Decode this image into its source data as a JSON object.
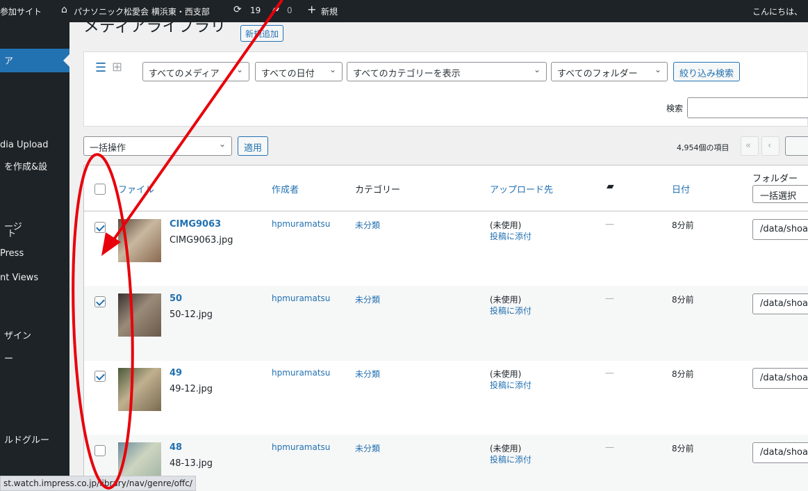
{
  "adminbar": {
    "site_label": "参加サイト",
    "site_name": "パナソニック松愛会 横浜東・西支部",
    "updates_count": "19",
    "comments_count": "0",
    "new_label": "新規",
    "greeting": "こんにちは、"
  },
  "sidebar": {
    "items": [
      "ア",
      "dia Upload",
      "を作成&設",
      "ージ",
      "ト",
      "Press",
      "nt Views",
      "ザイン",
      "ー",
      "ルドグルー"
    ]
  },
  "page": {
    "title": "メディアライブラリ",
    "add_new": "新規追加"
  },
  "filters": {
    "media_type": "すべてのメディア",
    "dates": "すべての日付",
    "categories": "すべてのカテゴリーを表示",
    "folders": "すべてのフォルダー",
    "filter_button": "絞り込み検索",
    "search_label": "検索"
  },
  "bulk": {
    "action": "一括操作",
    "apply": "適用",
    "item_count": "4,954個の項目",
    "first_page": "«",
    "prev_page": "‹"
  },
  "table": {
    "columns": {
      "file": "ファイル",
      "author": "作成者",
      "category": "カテゴリー",
      "uploaded_to": "アップロード先",
      "date": "日付",
      "folder": "フォルダー",
      "folder_bulk": "一括選択"
    },
    "rows": [
      {
        "title": "CIMG9063",
        "filename": "CIMG9063.jpg",
        "author": "hpmuramatsu",
        "category": "未分類",
        "uploaded": "(未使用)",
        "attach": "投稿に添付",
        "comments": "—",
        "date": "8分前",
        "folder": "/data/shoa",
        "checked": true
      },
      {
        "title": "50",
        "filename": "50-12.jpg",
        "author": "hpmuramatsu",
        "category": "未分類",
        "uploaded": "(未使用)",
        "attach": "投稿に添付",
        "comments": "—",
        "date": "8分前",
        "folder": "/data/shoa",
        "checked": true
      },
      {
        "title": "49",
        "filename": "49-12.jpg",
        "author": "hpmuramatsu",
        "category": "未分類",
        "uploaded": "(未使用)",
        "attach": "投稿に添付",
        "comments": "—",
        "date": "8分前",
        "folder": "/data/shoa",
        "checked": true
      },
      {
        "title": "48",
        "filename": "48-13.jpg",
        "author": "hpmuramatsu",
        "category": "未分類",
        "uploaded": "(未使用)",
        "attach": "投稿に添付",
        "comments": "—",
        "date": "8分前",
        "folder": "/data/shoa",
        "checked": false
      }
    ]
  },
  "statusbar": {
    "url": "st.watch.impress.co.jp/library/nav/genre/offc/"
  },
  "colors": {
    "annotation": "#e8000b",
    "accent": "#2271b1",
    "adminbar": "#1d2327"
  }
}
